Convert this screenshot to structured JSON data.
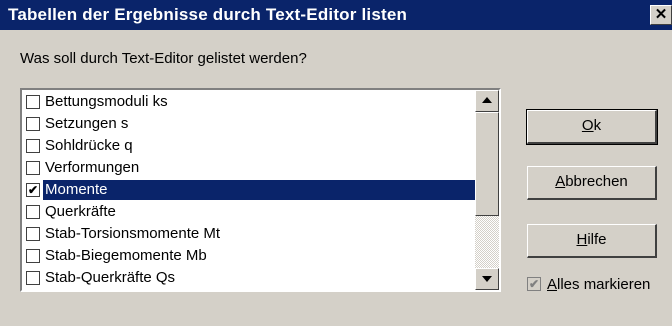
{
  "window": {
    "title": "Tabellen der Ergebnisse durch Text-Editor listen",
    "close_glyph": "✕"
  },
  "prompt": "Was soll durch Text-Editor gelistet werden?",
  "list": {
    "items": [
      {
        "label": "Bettungsmoduli ks",
        "checked": false,
        "selected": false
      },
      {
        "label": "Setzungen s",
        "checked": false,
        "selected": false
      },
      {
        "label": "Sohldrücke q",
        "checked": false,
        "selected": false
      },
      {
        "label": "Verformungen",
        "checked": false,
        "selected": false
      },
      {
        "label": "Momente",
        "checked": true,
        "selected": true
      },
      {
        "label": "Querkräfte",
        "checked": false,
        "selected": false
      },
      {
        "label": "Stab-Torsionsmomente Mt",
        "checked": false,
        "selected": false
      },
      {
        "label": "Stab-Biegemomente Mb",
        "checked": false,
        "selected": false
      },
      {
        "label": "Stab-Querkräfte Qs",
        "checked": false,
        "selected": false
      }
    ],
    "check_glyph": "✔"
  },
  "buttons": {
    "ok": {
      "accel": "O",
      "rest": "k"
    },
    "cancel": {
      "accel": "A",
      "rest": "bbrechen"
    },
    "help": {
      "accel": "H",
      "rest": "ilfe"
    }
  },
  "mark_all": {
    "accel": "A",
    "rest": "lles markieren",
    "checked": true,
    "enabled": false,
    "check_glyph": "✔"
  },
  "colors": {
    "titlebar": "#0a246a",
    "selection": "#0a246a",
    "face": "#d4d0c8"
  }
}
